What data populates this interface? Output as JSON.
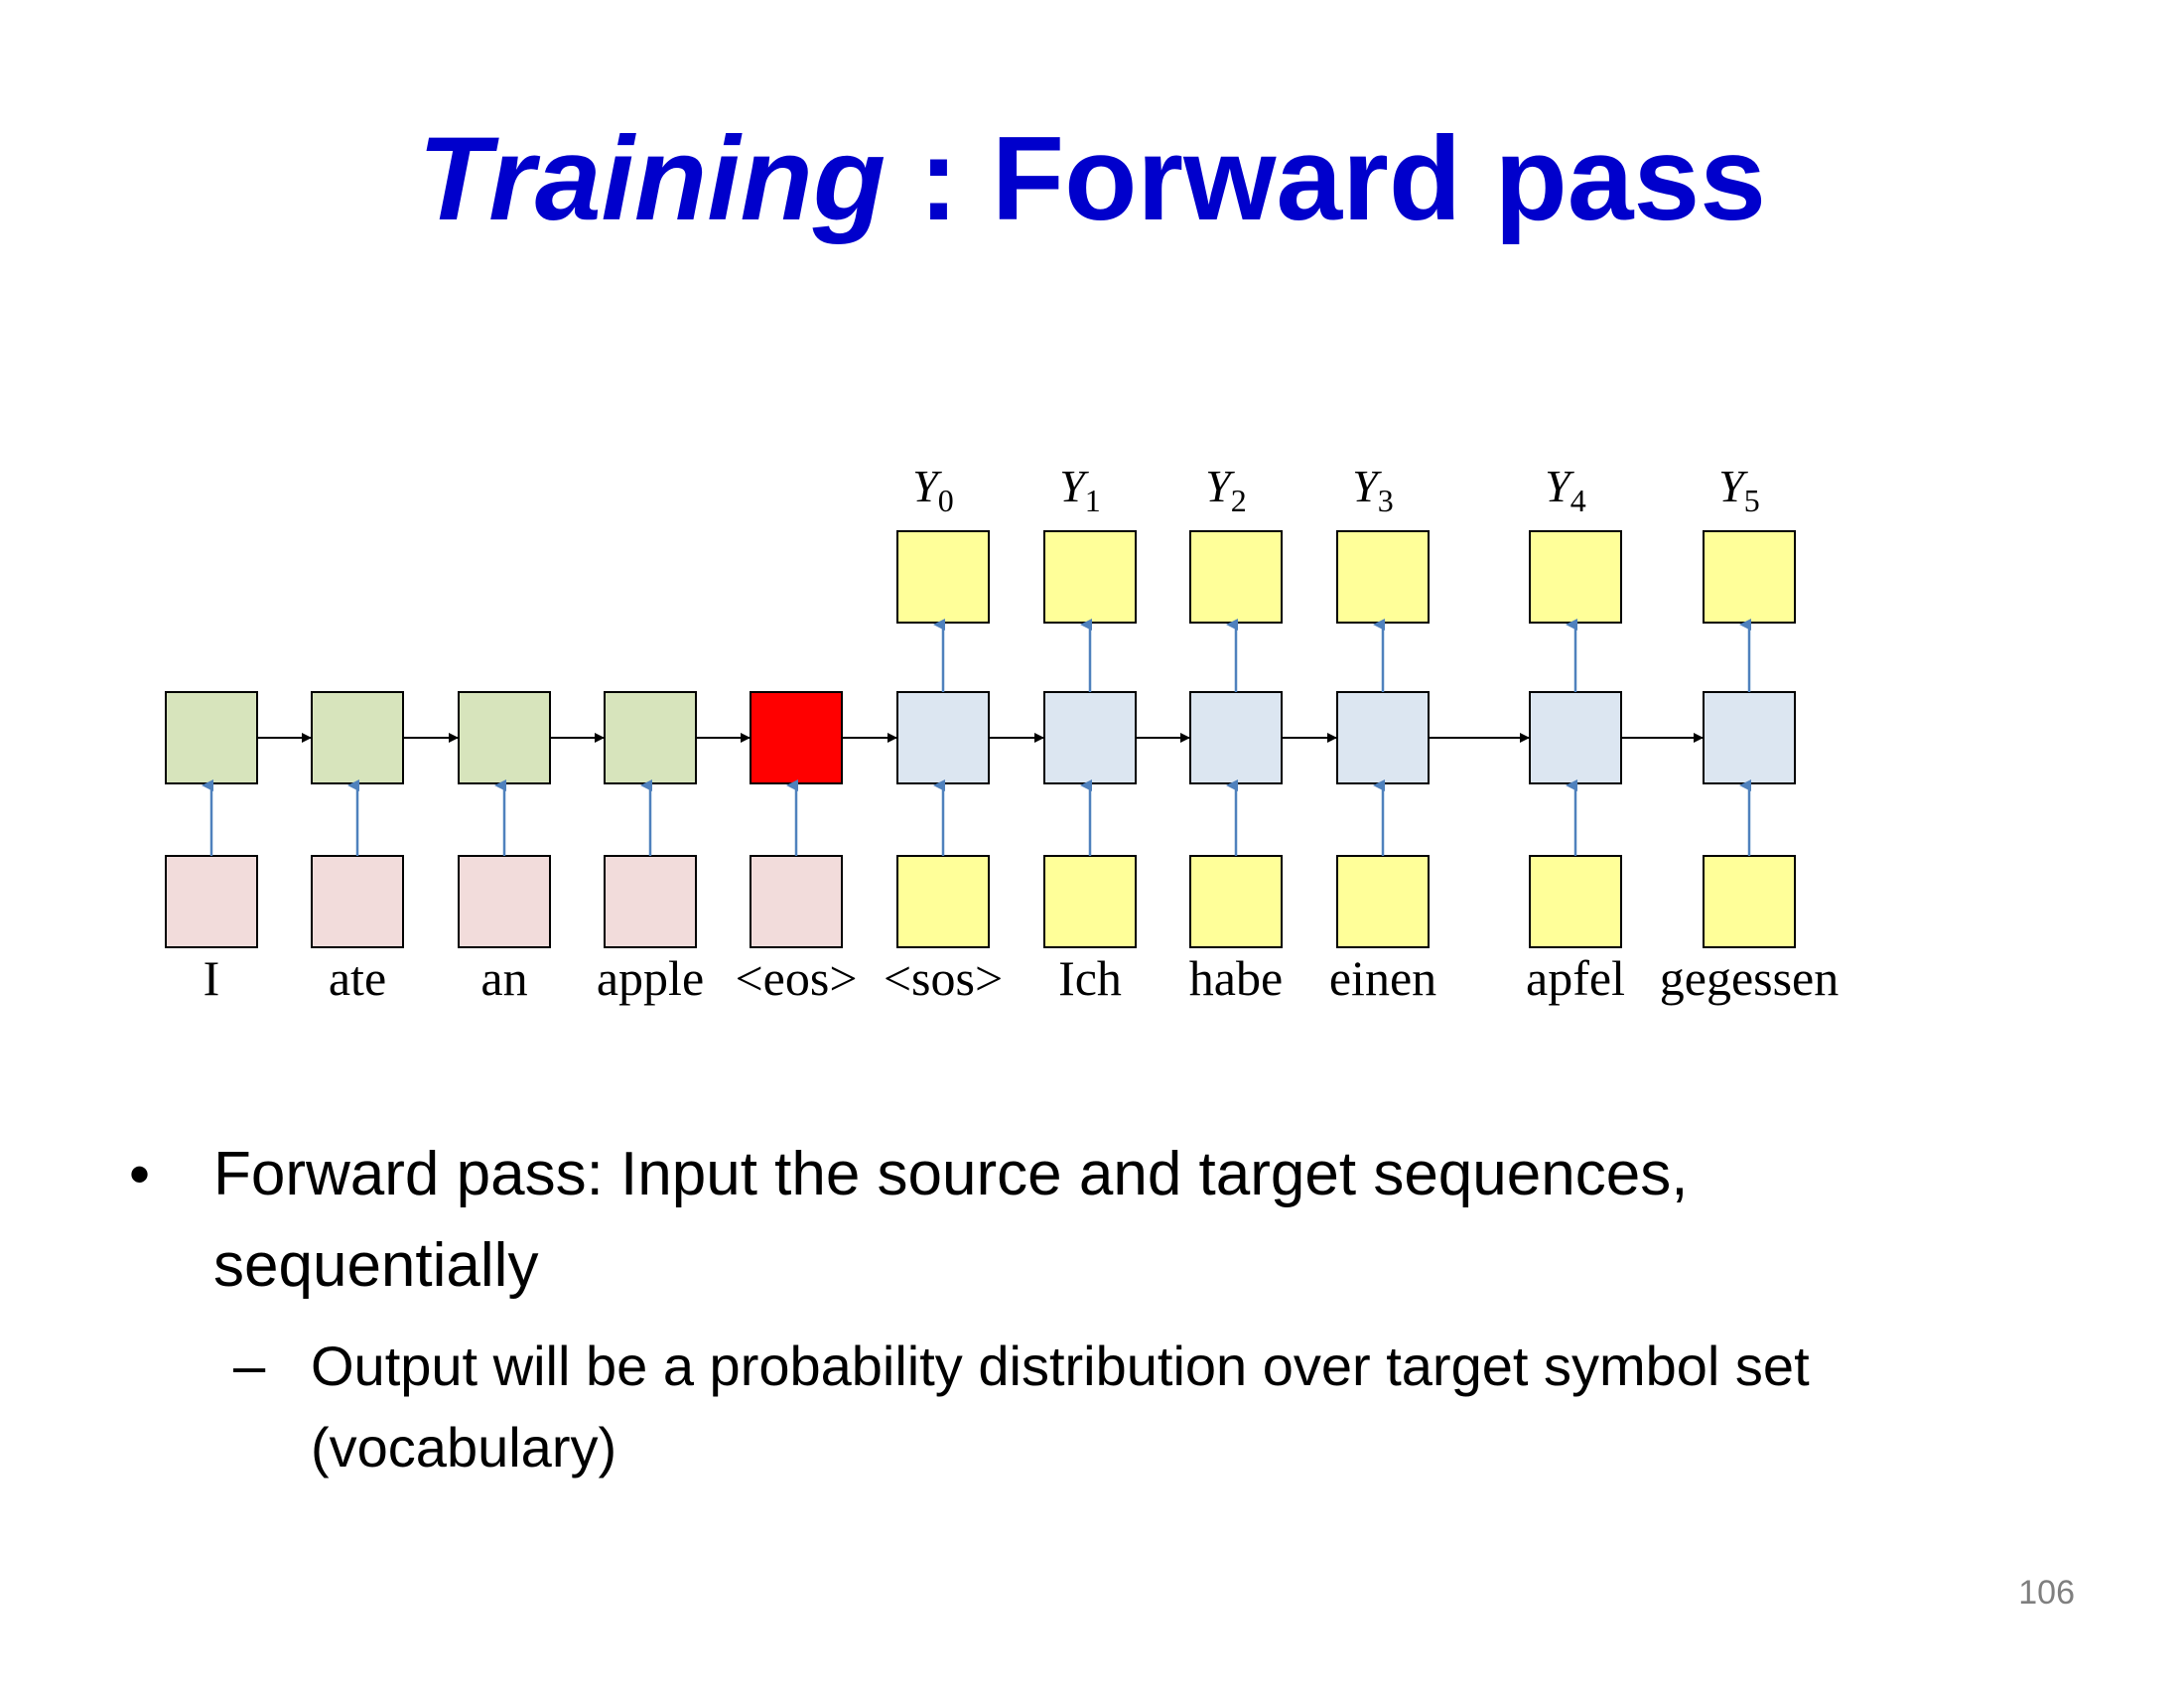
{
  "title": {
    "italic_part": "Training",
    "rest": " : Forward pass"
  },
  "diagram": {
    "source_words": [
      "I",
      "ate",
      "an",
      "apple",
      "<eos>"
    ],
    "target_inputs": [
      "<sos>",
      "Ich",
      "habe",
      "einen",
      "apfel",
      "gegessen"
    ],
    "outputs": [
      {
        "base": "Y",
        "sub": "0"
      },
      {
        "base": "Y",
        "sub": "1"
      },
      {
        "base": "Y",
        "sub": "2"
      },
      {
        "base": "Y",
        "sub": "3"
      },
      {
        "base": "Y",
        "sub": "4"
      },
      {
        "base": "Y",
        "sub": "5"
      }
    ],
    "colors": {
      "encoder_hidden": "#d7e4bc",
      "final_encoder_hidden": "#ff0000",
      "source_input": "#f2dcdb",
      "decoder_hidden": "#dce6f1",
      "target_input": "#ffff99",
      "output": "#ffff99",
      "arrow_up": "#4f81bd",
      "arrow_right": "#000000"
    }
  },
  "bullets": [
    {
      "text": "Forward pass:  Input the source and target sequences, sequentially",
      "sub": [
        "Output will be a probability distribution over target symbol set (vocabulary)"
      ]
    }
  ],
  "bullet_marks": {
    "main": "•",
    "sub": "–"
  },
  "page_number": "106"
}
